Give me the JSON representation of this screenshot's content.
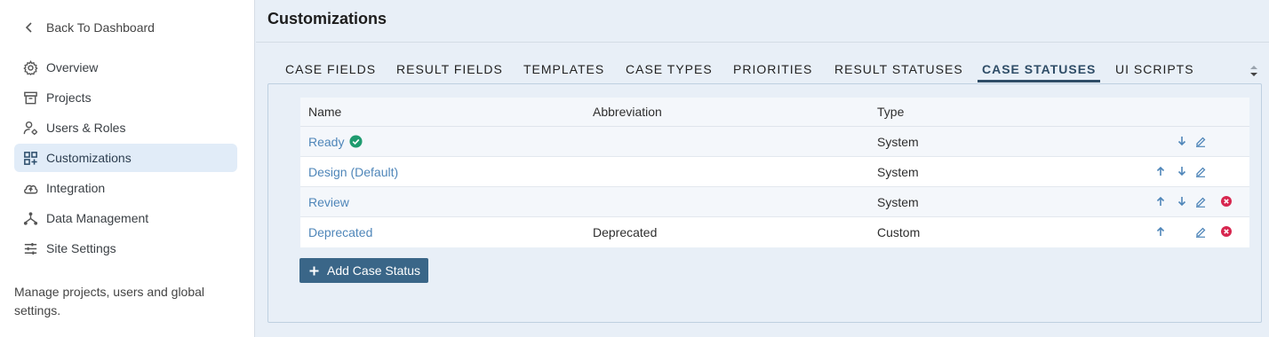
{
  "sidebar": {
    "back_label": "Back To Dashboard",
    "items": [
      {
        "label": "Overview",
        "icon": "gear-icon"
      },
      {
        "label": "Projects",
        "icon": "archive-icon"
      },
      {
        "label": "Users & Roles",
        "icon": "user-gear-icon"
      },
      {
        "label": "Customizations",
        "icon": "grid-plus-icon",
        "active": true
      },
      {
        "label": "Integration",
        "icon": "cloud-upload-icon"
      },
      {
        "label": "Data Management",
        "icon": "hierarchy-icon"
      },
      {
        "label": "Site Settings",
        "icon": "sliders-icon"
      }
    ],
    "description": "Manage projects, users and global settings."
  },
  "main": {
    "title": "Customizations",
    "tabs": [
      "CASE FIELDS",
      "RESULT FIELDS",
      "TEMPLATES",
      "CASE TYPES",
      "PRIORITIES",
      "RESULT STATUSES",
      "CASE STATUSES",
      "UI SCRIPTS"
    ],
    "active_tab": "CASE STATUSES"
  },
  "table": {
    "headers": {
      "name": "Name",
      "abbreviation": "Abbreviation",
      "type": "Type"
    },
    "rows": [
      {
        "name": "Ready",
        "abbreviation": "",
        "type": "System",
        "default_check": true,
        "actions": [
          "down",
          "edit"
        ]
      },
      {
        "name": "Design (Default)",
        "abbreviation": "",
        "type": "System",
        "actions": [
          "up",
          "down",
          "edit"
        ]
      },
      {
        "name": "Review",
        "abbreviation": "",
        "type": "System",
        "actions": [
          "up",
          "down",
          "edit",
          "delete"
        ]
      },
      {
        "name": "Deprecated",
        "abbreviation": "Deprecated",
        "type": "Custom",
        "actions": [
          "up",
          "edit",
          "delete"
        ]
      }
    ]
  },
  "add_button_label": "Add Case Status",
  "colors": {
    "accent": "#3a6688",
    "link": "#4f86b9",
    "active_nav_bg": "#e1ecf8",
    "check_green": "#1e9b6f",
    "delete_red": "#d7264f"
  }
}
